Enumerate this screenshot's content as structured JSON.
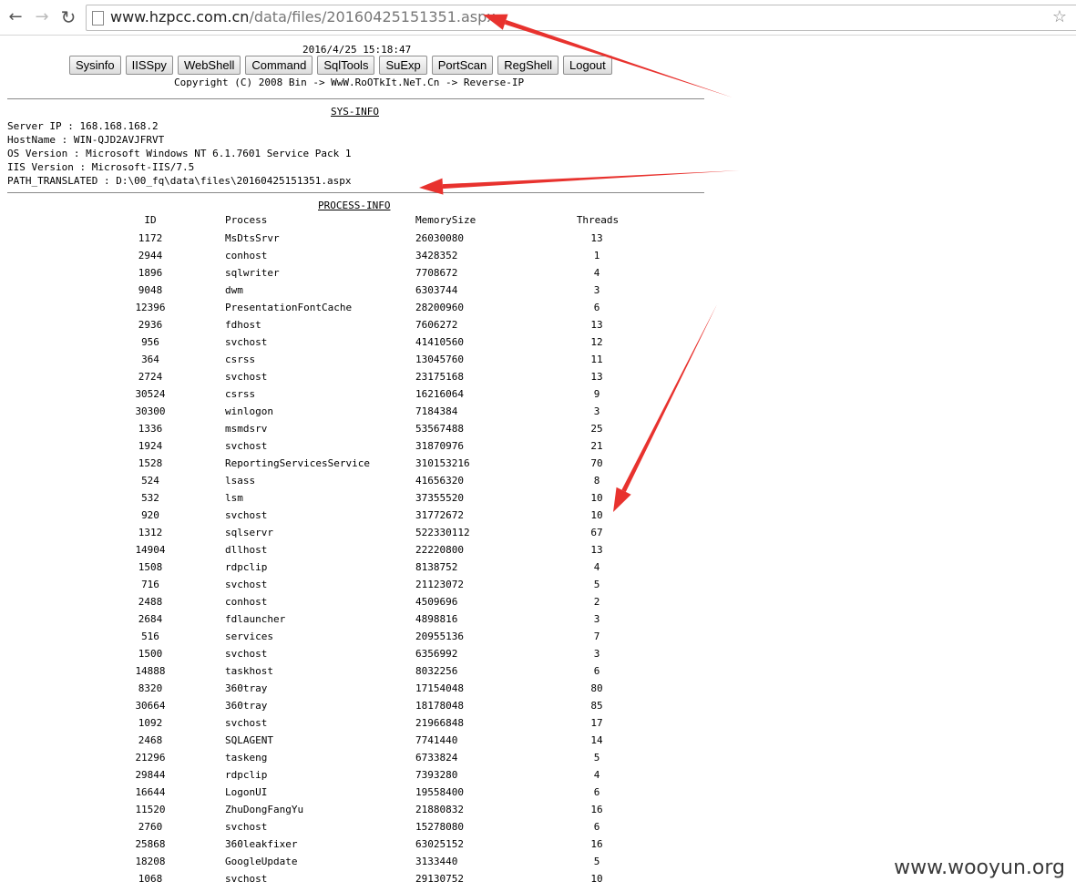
{
  "browser": {
    "back_glyph": "←",
    "forward_glyph": "→",
    "reload_glyph": "↻",
    "url_host": "www.hzpcc.com.cn",
    "url_path": "/data/files/20160425151351.aspx",
    "star_glyph": "☆",
    "icons": [
      "back-arrow-icon",
      "forward-arrow-icon",
      "reload-icon",
      "page-icon",
      "star-icon"
    ]
  },
  "page": {
    "datetime": "2016/4/25 15:18:47",
    "buttons": [
      "Sysinfo",
      "IISSpy",
      "WebShell",
      "Command",
      "SqlTools",
      "SuExp",
      "PortScan",
      "RegShell",
      "Logout"
    ],
    "copyright": "Copyright (C) 2008 Bin -> WwW.RoOTkIt.NeT.Cn -> Reverse-IP"
  },
  "sysinfo": {
    "title": "SYS-INFO",
    "lines": [
      "Server IP : 168.168.168.2",
      "HostName : WIN-QJD2AVJFRVT",
      "OS Version : Microsoft Windows NT 6.1.7601 Service Pack 1",
      "IIS Version : Microsoft-IIS/7.5",
      "PATH_TRANSLATED : D:\\00_fq\\data\\files\\20160425151351.aspx"
    ]
  },
  "process": {
    "title": "PROCESS-INFO",
    "headers": [
      "ID",
      "Process",
      "MemorySize",
      "Threads"
    ],
    "rows": [
      [
        "1172",
        "MsDtsSrvr",
        "26030080",
        "13"
      ],
      [
        "2944",
        "conhost",
        "3428352",
        "1"
      ],
      [
        "1896",
        "sqlwriter",
        "7708672",
        "4"
      ],
      [
        "9048",
        "dwm",
        "6303744",
        "3"
      ],
      [
        "12396",
        "PresentationFontCache",
        "28200960",
        "6"
      ],
      [
        "2936",
        "fdhost",
        "7606272",
        "13"
      ],
      [
        "956",
        "svchost",
        "41410560",
        "12"
      ],
      [
        "364",
        "csrss",
        "13045760",
        "11"
      ],
      [
        "2724",
        "svchost",
        "23175168",
        "13"
      ],
      [
        "30524",
        "csrss",
        "16216064",
        "9"
      ],
      [
        "30300",
        "winlogon",
        "7184384",
        "3"
      ],
      [
        "1336",
        "msmdsrv",
        "53567488",
        "25"
      ],
      [
        "1924",
        "svchost",
        "31870976",
        "21"
      ],
      [
        "1528",
        "ReportingServicesService",
        "310153216",
        "70"
      ],
      [
        "524",
        "lsass",
        "41656320",
        "8"
      ],
      [
        "532",
        "lsm",
        "37355520",
        "10"
      ],
      [
        "920",
        "svchost",
        "31772672",
        "10"
      ],
      [
        "1312",
        "sqlservr",
        "522330112",
        "67"
      ],
      [
        "14904",
        "dllhost",
        "22220800",
        "13"
      ],
      [
        "1508",
        "rdpclip",
        "8138752",
        "4"
      ],
      [
        "716",
        "svchost",
        "21123072",
        "5"
      ],
      [
        "2488",
        "conhost",
        "4509696",
        "2"
      ],
      [
        "2684",
        "fdlauncher",
        "4898816",
        "3"
      ],
      [
        "516",
        "services",
        "20955136",
        "7"
      ],
      [
        "1500",
        "svchost",
        "6356992",
        "3"
      ],
      [
        "14888",
        "taskhost",
        "8032256",
        "6"
      ],
      [
        "8320",
        "360tray",
        "17154048",
        "80"
      ],
      [
        "30664",
        "360tray",
        "18178048",
        "85"
      ],
      [
        "1092",
        "svchost",
        "21966848",
        "17"
      ],
      [
        "2468",
        "SQLAGENT",
        "7741440",
        "14"
      ],
      [
        "21296",
        "taskeng",
        "6733824",
        "5"
      ],
      [
        "29844",
        "rdpclip",
        "7393280",
        "4"
      ],
      [
        "16644",
        "LogonUI",
        "19558400",
        "6"
      ],
      [
        "11520",
        "ZhuDongFangYu",
        "21880832",
        "16"
      ],
      [
        "2760",
        "svchost",
        "15278080",
        "6"
      ],
      [
        "25868",
        "360leakfixer",
        "63025152",
        "16"
      ],
      [
        "18208",
        "GoogleUpdate",
        "3133440",
        "5"
      ],
      [
        "1068",
        "svchost",
        "29130752",
        "10"
      ]
    ]
  },
  "watermark": "www.wooyun.org",
  "annotation_color": "#e8322e"
}
